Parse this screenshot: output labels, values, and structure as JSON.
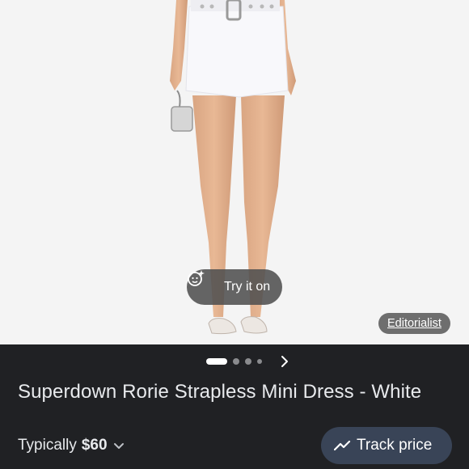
{
  "product": {
    "title": "Superdown Rorie Strapless Mini Dress - White",
    "price_prefix": "Typically",
    "price": "$60"
  },
  "image_actions": {
    "try_on_label": "Try it on",
    "source_label": "Editorialist"
  },
  "carousel": {
    "total_indicators": 4,
    "active_index": 0
  },
  "actions": {
    "track_price_label": "Track price"
  },
  "icons": {
    "try_on": "face-sparkle-icon",
    "next": "chevron-right-icon",
    "price_expand": "chevron-down-icon",
    "track_price": "trending-up-icon"
  },
  "colors": {
    "panel_bg": "#202124",
    "track_button_bg": "#394457",
    "image_bg": "#f4f4f4"
  }
}
